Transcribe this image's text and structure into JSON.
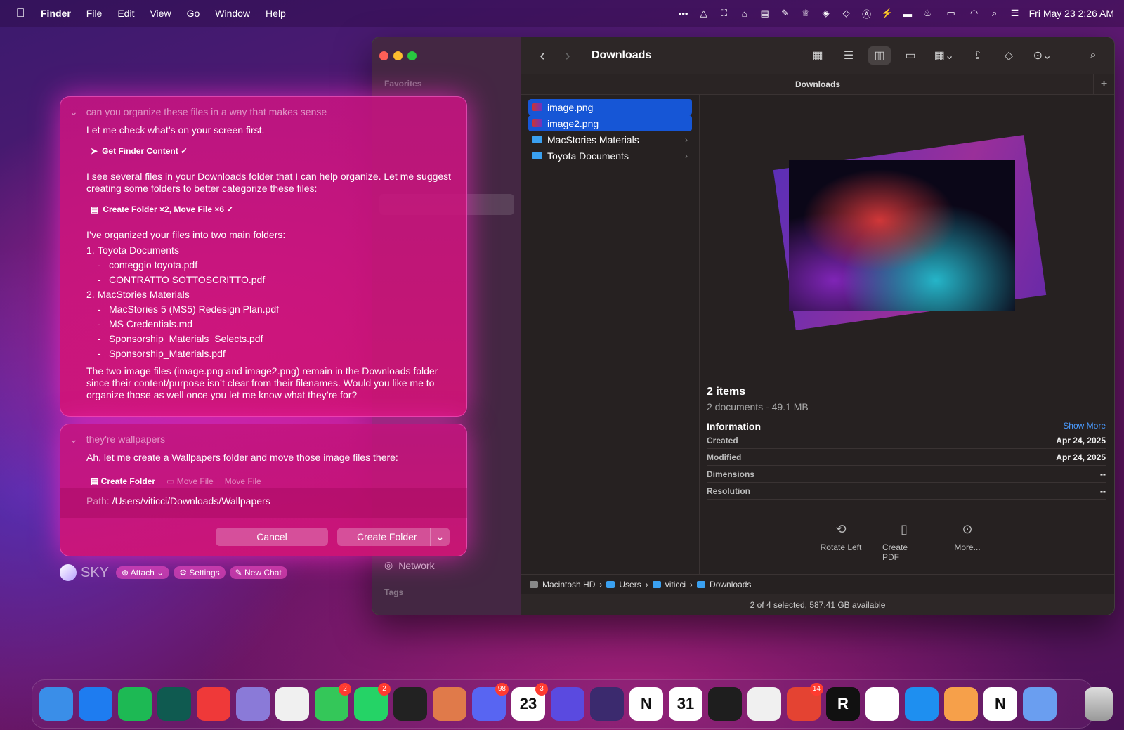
{
  "menubar": {
    "app": "Finder",
    "items": [
      "File",
      "Edit",
      "View",
      "Go",
      "Window",
      "Help"
    ],
    "clock": "Fri May 23  2:26 AM"
  },
  "finder": {
    "title": "Downloads",
    "sidebar": {
      "favorites": "Favorites",
      "network": "Network",
      "tags": "Tags"
    },
    "path_header": "Downloads",
    "files": [
      {
        "name": "image.png",
        "selected": true,
        "kind": "image"
      },
      {
        "name": "image2.png",
        "selected": true,
        "kind": "image"
      },
      {
        "name": "MacStories Materials",
        "selected": false,
        "kind": "folder"
      },
      {
        "name": "Toyota Documents",
        "selected": false,
        "kind": "folder"
      }
    ],
    "preview": {
      "count": "2 items",
      "summary": "2 documents - 49.1 MB",
      "info_label": "Information",
      "show_more": "Show More",
      "rows": [
        {
          "k": "Created",
          "v": "Apr 24, 2025"
        },
        {
          "k": "Modified",
          "v": "Apr 24, 2025"
        },
        {
          "k": "Dimensions",
          "v": "--"
        },
        {
          "k": "Resolution",
          "v": "--"
        }
      ],
      "actions": [
        "Rotate Left",
        "Create PDF",
        "More..."
      ]
    },
    "breadcrumbs": [
      "Macintosh HD",
      "Users",
      "viticci",
      "Downloads"
    ],
    "status": "2 of 4 selected, 587.41 GB available"
  },
  "chat": {
    "q1": "can you organize these files in a way that makes sense",
    "a1": "Let me check what’s on your screen first.",
    "tool1": "Get Finder Content ✓",
    "a2": "I see several files in your Downloads folder that I can help organize. Let me suggest creating some folders to better categorize these files:",
    "tool2": "Create Folder ×2, Move File ×6 ✓",
    "a3": "I’ve organized your files into two main folders:",
    "folders": [
      {
        "n": "1.",
        "name": "Toyota Documents",
        "files": [
          "conteggio toyota.pdf",
          "CONTRATTO SOTTOSCRITTO.pdf"
        ]
      },
      {
        "n": "2.",
        "name": "MacStories Materials",
        "files": [
          "MacStories 5 (MS5) Redesign Plan.pdf",
          "MS Credentials.md",
          "Sponsorship_Materials_Selects.pdf",
          "Sponsorship_Materials.pdf"
        ]
      }
    ],
    "a4": "The two image files (image.png and image2.png) remain in the Downloads folder since their content/purpose isn’t clear from their filenames. Would you like me to organize those as well once you let me know what they’re for?",
    "q2": "they're wallpapers",
    "a5": "Ah, let me create a Wallpapers folder and move those image files there:",
    "tools3": [
      "Create Folder",
      "Move File",
      "Move File"
    ],
    "path_label": "Path:",
    "path_value": "/Users/viticci/Downloads/Wallpapers",
    "cancel": "Cancel",
    "confirm": "Create Folder"
  },
  "sky": {
    "name": "SKY",
    "buttons": [
      "Attach",
      "Settings",
      "New Chat"
    ]
  },
  "dock": [
    {
      "name": "Finder",
      "color": "#3a8ee8"
    },
    {
      "name": "App Store",
      "color": "#1e7cf0"
    },
    {
      "name": "Spotify",
      "color": "#1db954"
    },
    {
      "name": "Terminal",
      "color": "#0f5a50"
    },
    {
      "name": "Vivaldi",
      "color": "#ef3939"
    },
    {
      "name": "TablePlus",
      "color": "#8a7ad8"
    },
    {
      "name": "Photos",
      "color": "#f0f0f0"
    },
    {
      "name": "Messages",
      "color": "#34c759",
      "badge": "2"
    },
    {
      "name": "WhatsApp",
      "color": "#25d366",
      "badge": "2"
    },
    {
      "name": "ChatGPT",
      "color": "#222222"
    },
    {
      "name": "Claude",
      "color": "#e07a4a"
    },
    {
      "name": "Discord",
      "color": "#5865f2",
      "badge": "98"
    },
    {
      "name": "Calendar",
      "color": "#ffffff",
      "badge": "3",
      "label": "23"
    },
    {
      "name": "Shortcuts",
      "color": "#5a4ae0"
    },
    {
      "name": "Obsidian",
      "color": "#3b2a6e"
    },
    {
      "name": "Notion",
      "color": "#ffffff",
      "label": "N"
    },
    {
      "name": "Notion Calendar",
      "color": "#ffffff",
      "label": "31"
    },
    {
      "name": "Layers",
      "color": "#1e1e1e"
    },
    {
      "name": "TextEdit",
      "color": "#f0f0f0"
    },
    {
      "name": "Todoist",
      "color": "#e44332",
      "badge": "14"
    },
    {
      "name": "Reeder",
      "color": "#111111",
      "label": "R"
    },
    {
      "name": "Mastodon",
      "color": "#ffffff"
    },
    {
      "name": "CloudMounter",
      "color": "#1e8ff0"
    },
    {
      "name": "Pages",
      "color": "#f6a04a"
    },
    {
      "name": "Notion 2",
      "color": "#ffffff",
      "label": "N"
    },
    {
      "name": "Sky",
      "color": "#6a9ef0"
    }
  ],
  "trash": "Trash"
}
